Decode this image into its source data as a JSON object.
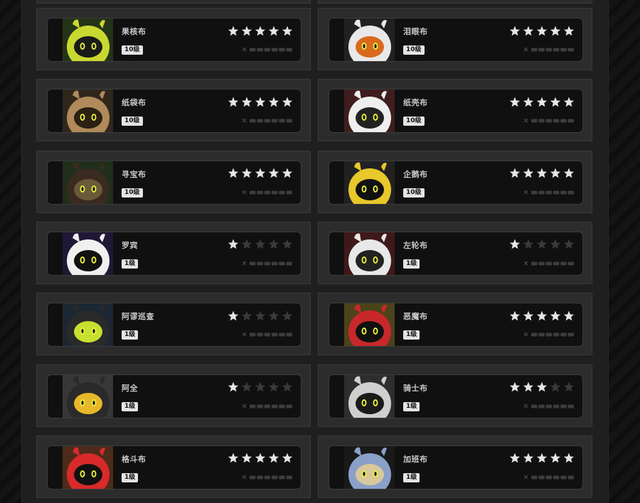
{
  "colors": {
    "star_on": "#e6e6e6",
    "star_off": "#3a3a3a",
    "panel": "#1f1f1f",
    "card": "#2c2c2c",
    "inner": "#101010"
  },
  "cards": [
    {
      "name": "果核布",
      "level": "10级",
      "stars": 5,
      "portrait": "yellow-round-bangboo-portrait"
    },
    {
      "name": "泪眼布",
      "level": "10级",
      "stars": 5,
      "portrait": "goggles-bangboo-portrait"
    },
    {
      "name": "纸袋布",
      "level": "10级",
      "stars": 5,
      "portrait": "paper-bag-bangboo-portrait"
    },
    {
      "name": "纸壳布",
      "level": "10级",
      "stars": 5,
      "portrait": "paper-shell-bangboo-portrait"
    },
    {
      "name": "寻宝布",
      "level": "10级",
      "stars": 5,
      "portrait": "treasure-hat-bangboo-portrait"
    },
    {
      "name": "企鹅布",
      "level": "10级",
      "stars": 5,
      "portrait": "penguin-bangboo-portrait"
    },
    {
      "name": "罗宾",
      "level": "1级",
      "stars": 1,
      "portrait": "robin-bangboo-portrait"
    },
    {
      "name": "左轮布",
      "level": "1级",
      "stars": 1,
      "portrait": "revolver-bangboo-portrait"
    },
    {
      "name": "阿谬巡查",
      "level": "1级",
      "stars": 1,
      "portrait": "patrol-bangboo-portrait"
    },
    {
      "name": "恶魔布",
      "level": "1级",
      "stars": 5,
      "portrait": "red-devil-bangboo-portrait"
    },
    {
      "name": "阿全",
      "level": "1级",
      "stars": 1,
      "portrait": "hardhat-bangboo-portrait"
    },
    {
      "name": "骑士布",
      "level": "1级",
      "stars": 3,
      "portrait": "knight-bangboo-portrait"
    },
    {
      "name": "格斗布",
      "level": "1级",
      "stars": 5,
      "portrait": "red-boxer-bangboo-portrait"
    },
    {
      "name": "加班布",
      "level": "1级",
      "stars": 5,
      "portrait": "overtime-bangboo-portrait"
    }
  ]
}
